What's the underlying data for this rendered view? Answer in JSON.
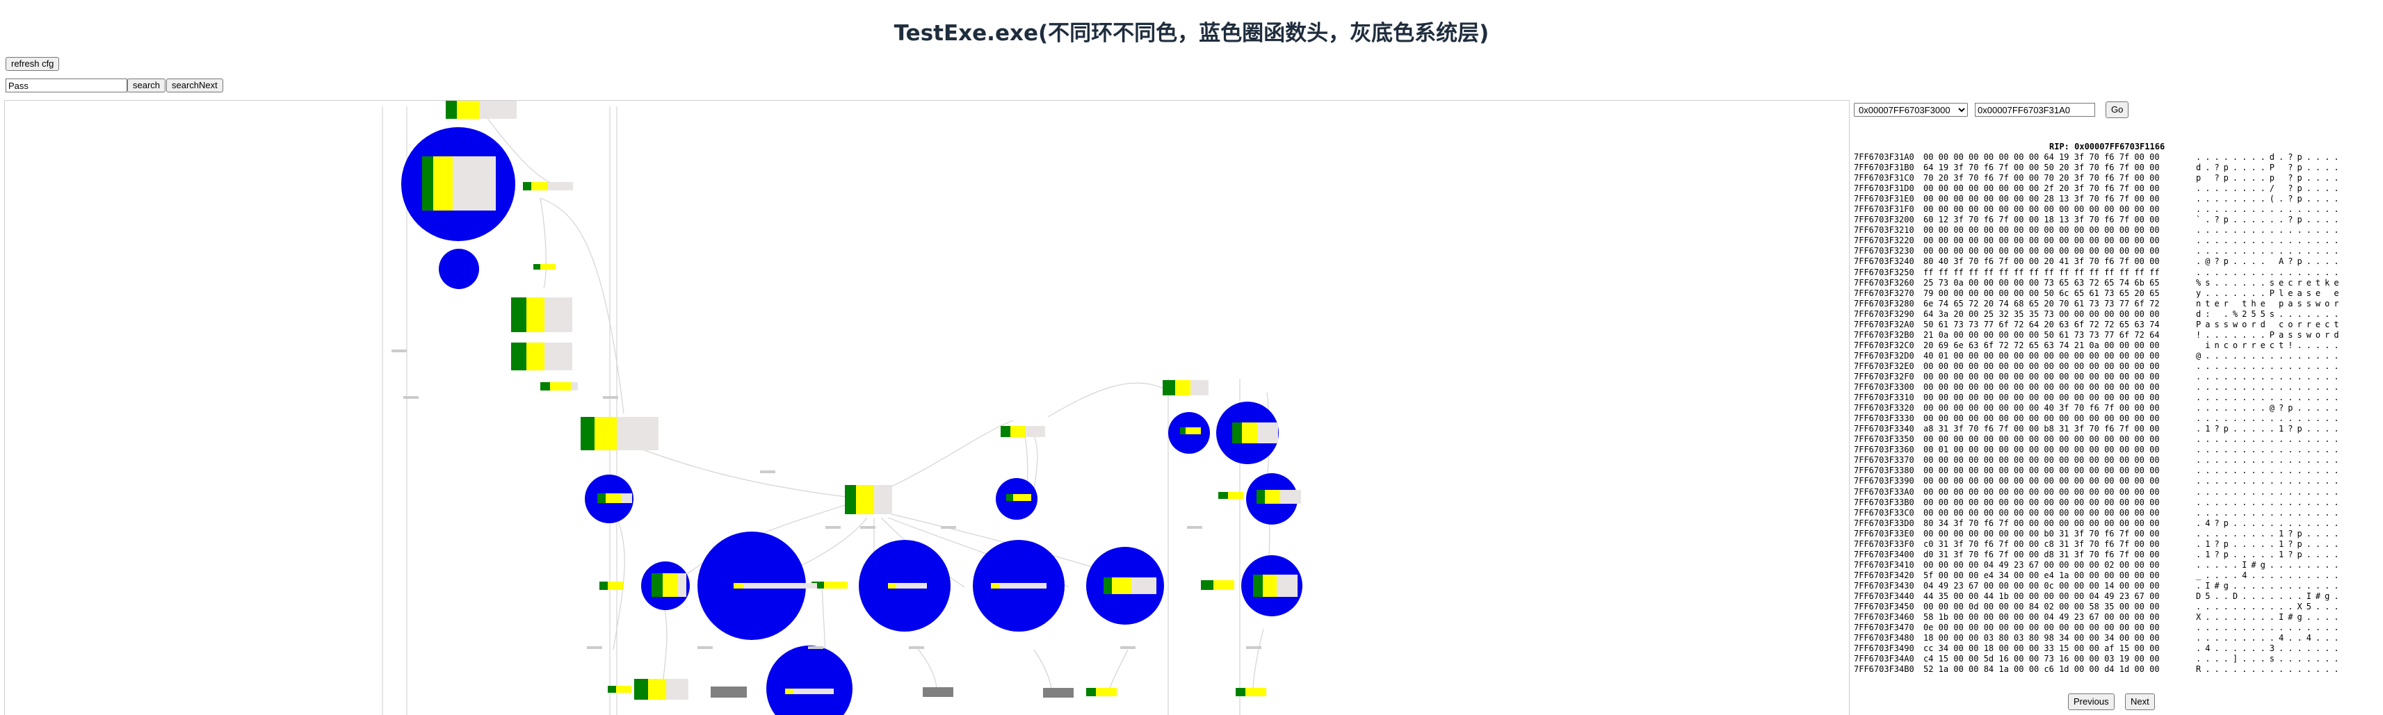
{
  "header": {
    "title": "TestExe.exe(不同环不同色，蓝色圈函数头，灰底色系统层)"
  },
  "toolbar": {
    "refresh_label": "refresh cfg",
    "search_value": "Pass",
    "search_label": "search",
    "search_next_label": "searchNext"
  },
  "memory": {
    "region_selected": "0x00007FF6703F3000",
    "address_value": "0x00007FF6703F31A0",
    "go_label": "Go",
    "rip_label": "RIP: 0x00007FF6703F1166",
    "rows": [
      {
        "addr": "7FF6703F31A0",
        "hex": "00 00 00 00 00 00 00 00 64 19 3f 70 f6 7f 00 00",
        "ascii": "........d.?p...."
      },
      {
        "addr": "7FF6703F31B0",
        "hex": "64 19 3f 70 f6 7f 00 00 50 20 3f 70 f6 7f 00 00",
        "ascii": "d.?p....P ?p...."
      },
      {
        "addr": "7FF6703F31C0",
        "hex": "70 20 3f 70 f6 7f 00 00 70 20 3f 70 f6 7f 00 00",
        "ascii": "p ?p....p ?p...."
      },
      {
        "addr": "7FF6703F31D0",
        "hex": "00 00 00 00 00 00 00 00 2f 20 3f 70 f6 7f 00 00",
        "ascii": "......../ ?p...."
      },
      {
        "addr": "7FF6703F31E0",
        "hex": "00 00 00 00 00 00 00 00 28 13 3f 70 f6 7f 00 00",
        "ascii": "........(.?p...."
      },
      {
        "addr": "7FF6703F31F0",
        "hex": "00 00 00 00 00 00 00 00 00 00 00 00 00 00 00 00",
        "ascii": "................"
      },
      {
        "addr": "7FF6703F3200",
        "hex": "60 12 3f 70 f6 7f 00 00 18 13 3f 70 f6 7f 00 00",
        "ascii": "`.?p......?p...."
      },
      {
        "addr": "7FF6703F3210",
        "hex": "00 00 00 00 00 00 00 00 00 00 00 00 00 00 00 00",
        "ascii": "................"
      },
      {
        "addr": "7FF6703F3220",
        "hex": "00 00 00 00 00 00 00 00 00 00 00 00 00 00 00 00",
        "ascii": "................"
      },
      {
        "addr": "7FF6703F3230",
        "hex": "00 00 00 00 00 00 00 00 00 00 00 00 00 00 00 00",
        "ascii": "................"
      },
      {
        "addr": "7FF6703F3240",
        "hex": "80 40 3f 70 f6 7f 00 00 20 41 3f 70 f6 7f 00 00",
        "ascii": ".@?p.... A?p...."
      },
      {
        "addr": "7FF6703F3250",
        "hex": "ff ff ff ff ff ff ff ff ff ff ff ff ff ff ff ff",
        "ascii": "................"
      },
      {
        "addr": "7FF6703F3260",
        "hex": "25 73 0a 00 00 00 00 00 73 65 63 72 65 74 6b 65",
        "ascii": "%s......secretke"
      },
      {
        "addr": "7FF6703F3270",
        "hex": "79 00 00 00 00 00 00 00 50 6c 65 61 73 65 20 65",
        "ascii": "y.......Please e"
      },
      {
        "addr": "7FF6703F3280",
        "hex": "6e 74 65 72 20 74 68 65 20 70 61 73 73 77 6f 72",
        "ascii": "nter the passwor"
      },
      {
        "addr": "7FF6703F3290",
        "hex": "64 3a 20 00 25 32 35 35 73 00 00 00 00 00 00 00",
        "ascii": "d: .%255s......."
      },
      {
        "addr": "7FF6703F32A0",
        "hex": "50 61 73 73 77 6f 72 64 20 63 6f 72 72 65 63 74",
        "ascii": "Password correct"
      },
      {
        "addr": "7FF6703F32B0",
        "hex": "21 0a 00 00 00 00 00 00 50 61 73 73 77 6f 72 64",
        "ascii": "!.......Password"
      },
      {
        "addr": "7FF6703F32C0",
        "hex": "20 69 6e 63 6f 72 72 65 63 74 21 0a 00 00 00 00",
        "ascii": " incorrect!....."
      },
      {
        "addr": "7FF6703F32D0",
        "hex": "40 01 00 00 00 00 00 00 00 00 00 00 00 00 00 00",
        "ascii": "@..............."
      },
      {
        "addr": "7FF6703F32E0",
        "hex": "00 00 00 00 00 00 00 00 00 00 00 00 00 00 00 00",
        "ascii": "................"
      },
      {
        "addr": "7FF6703F32F0",
        "hex": "00 00 00 00 00 00 00 00 00 00 00 00 00 00 00 00",
        "ascii": "................"
      },
      {
        "addr": "7FF6703F3300",
        "hex": "00 00 00 00 00 00 00 00 00 00 00 00 00 00 00 00",
        "ascii": "................"
      },
      {
        "addr": "7FF6703F3310",
        "hex": "00 00 00 00 00 00 00 00 00 00 00 00 00 00 00 00",
        "ascii": "................"
      },
      {
        "addr": "7FF6703F3320",
        "hex": "00 00 00 00 00 00 00 00 40 3f 70 f6 7f 00 00 00",
        "ascii": "........@?p....."
      },
      {
        "addr": "7FF6703F3330",
        "hex": "00 00 00 00 00 00 00 00 00 00 00 00 00 00 00 00",
        "ascii": "................"
      },
      {
        "addr": "7FF6703F3340",
        "hex": "a8 31 3f 70 f6 7f 00 00 b8 31 3f 70 f6 7f 00 00",
        "ascii": ".1?p.....1?p...."
      },
      {
        "addr": "7FF6703F3350",
        "hex": "00 00 00 00 00 00 00 00 00 00 00 00 00 00 00 00",
        "ascii": "................"
      },
      {
        "addr": "7FF6703F3360",
        "hex": "00 01 00 00 00 00 00 00 00 00 00 00 00 00 00 00",
        "ascii": "................"
      },
      {
        "addr": "7FF6703F3370",
        "hex": "00 00 00 00 00 00 00 00 00 00 00 00 00 00 00 00",
        "ascii": "................"
      },
      {
        "addr": "7FF6703F3380",
        "hex": "00 00 00 00 00 00 00 00 00 00 00 00 00 00 00 00",
        "ascii": "................"
      },
      {
        "addr": "7FF6703F3390",
        "hex": "00 00 00 00 00 00 00 00 00 00 00 00 00 00 00 00",
        "ascii": "................"
      },
      {
        "addr": "7FF6703F33A0",
        "hex": "00 00 00 00 00 00 00 00 00 00 00 00 00 00 00 00",
        "ascii": "................"
      },
      {
        "addr": "7FF6703F33B0",
        "hex": "00 00 00 00 00 00 00 00 00 00 00 00 00 00 00 00",
        "ascii": "................"
      },
      {
        "addr": "7FF6703F33C0",
        "hex": "00 00 00 00 00 00 00 00 00 00 00 00 00 00 00 00",
        "ascii": "................"
      },
      {
        "addr": "7FF6703F33D0",
        "hex": "80 34 3f 70 f6 7f 00 00 00 00 00 00 00 00 00 00",
        "ascii": ".4?p............"
      },
      {
        "addr": "7FF6703F33E0",
        "hex": "00 00 00 00 00 00 00 00 b0 31 3f 70 f6 7f 00 00",
        "ascii": ".........1?p...."
      },
      {
        "addr": "7FF6703F33F0",
        "hex": "c0 31 3f 70 f6 7f 00 00 c8 31 3f 70 f6 7f 00 00",
        "ascii": ".1?p.....1?p...."
      },
      {
        "addr": "7FF6703F3400",
        "hex": "d0 31 3f 70 f6 7f 00 00 d8 31 3f 70 f6 7f 00 00",
        "ascii": ".1?p.....1?p...."
      },
      {
        "addr": "7FF6703F3410",
        "hex": "00 00 00 00 04 49 23 67 00 00 00 00 02 00 00 00",
        "ascii": ".....I#g........"
      },
      {
        "addr": "7FF6703F3420",
        "hex": "5f 00 00 00 e4 34 00 00 e4 1a 00 00 00 00 00 00",
        "ascii": "_....4.........."
      },
      {
        "addr": "7FF6703F3430",
        "hex": "04 49 23 67 00 00 00 00 0c 00 00 00 14 00 00 00",
        "ascii": ".I#g............"
      },
      {
        "addr": "7FF6703F3440",
        "hex": "44 35 00 00 44 1b 00 00 00 00 00 04 49 23 67 00",
        "ascii": "D5..D.......I#g."
      },
      {
        "addr": "7FF6703F3450",
        "hex": "00 00 00 0d 00 00 00 84 02 00 00 58 35 00 00 00",
        "ascii": "...........X5..."
      },
      {
        "addr": "7FF6703F3460",
        "hex": "58 1b 00 00 00 00 00 00 04 49 23 67 00 00 00 00",
        "ascii": "X........I#g...."
      },
      {
        "addr": "7FF6703F3470",
        "hex": "0e 00 00 00 00 00 00 00 00 00 00 00 00 00 00 00",
        "ascii": "................"
      },
      {
        "addr": "7FF6703F3480",
        "hex": "18 00 00 00 03 80 03 80 98 34 00 00 34 00 00 00",
        "ascii": ".........4..4..."
      },
      {
        "addr": "7FF6703F3490",
        "hex": "cc 34 00 00 18 00 00 00 33 15 00 00 af 15 00 00",
        "ascii": ".4......3......."
      },
      {
        "addr": "7FF6703F34A0",
        "hex": "c4 15 00 00 5d 16 00 00 73 16 00 00 03 19 00 00",
        "ascii": "....]...s......."
      },
      {
        "addr": "7FF6703F34B0",
        "hex": "52 1a 00 00 84 1a 00 00 c6 1d 00 00 d4 1d 00 00",
        "ascii": "R..............."
      }
    ],
    "prev_label": "Previous",
    "next_label": "Next"
  },
  "colors": {
    "function_head": "#0000ee",
    "block_left": "#008000",
    "block_fill": "#ffff00",
    "system_block": "#808080",
    "edge": "#cfcfcf",
    "title": "#1f2d3d"
  }
}
